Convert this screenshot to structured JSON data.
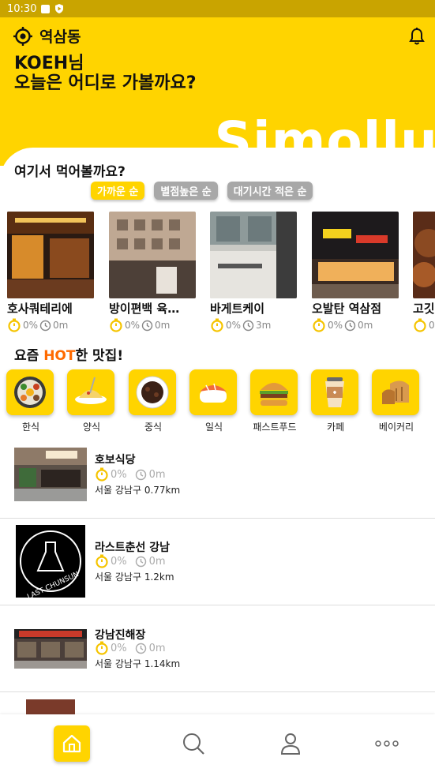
{
  "status": {
    "time": "10:30"
  },
  "header": {
    "location": "역삼동",
    "greeting_line1": "KOEH님",
    "greeting_line2": "오늘은 어디로 가볼까요?",
    "logo_text": "Simollu"
  },
  "nearby": {
    "title": "여기서 먹어볼까요?",
    "sort_chips": [
      "가까운 순",
      "별점높은 순",
      "대기시간 적은 순"
    ],
    "active_chip": 0,
    "restaurants": [
      {
        "name": "호사쿼테리에",
        "rate": "0%",
        "time": "0m"
      },
      {
        "name": "방이편백 육…",
        "rate": "0%",
        "time": "0m"
      },
      {
        "name": "바게트케이",
        "rate": "0%",
        "time": "3m"
      },
      {
        "name": "오발탄 역삼점",
        "rate": "0%",
        "time": "0m"
      },
      {
        "name": "고깃",
        "rate": "0",
        "time": ""
      }
    ]
  },
  "hot": {
    "title_prefix": "요즘 ",
    "title_highlight": "HOT",
    "title_suffix": "한 맛집!",
    "categories": [
      "한식",
      "양식",
      "중식",
      "일식",
      "패스트푸드",
      "카페",
      "베이커리"
    ]
  },
  "list": [
    {
      "name": "호보식당",
      "rate": "0%",
      "time": "0m",
      "address": "서울 강남구 0.77km"
    },
    {
      "name": "라스트춘선 강남",
      "rate": "0%",
      "time": "0m",
      "address": "서울 강남구 1.2km",
      "thumb_text": "LAST CHUNSUN"
    },
    {
      "name": "강남진해장",
      "rate": "0%",
      "time": "0m",
      "address": "서울 강남구 1.14km"
    }
  ],
  "colors": {
    "brand_yellow": "#ffd400",
    "hot_orange": "#ff6a00",
    "chip_grey": "#a8a8a8"
  },
  "nav_icons": [
    "home-icon",
    "search-icon",
    "person-icon",
    "more-icon"
  ]
}
